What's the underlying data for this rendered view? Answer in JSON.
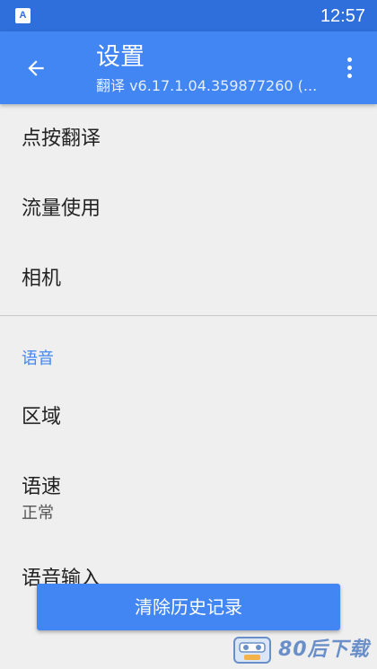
{
  "status_bar": {
    "app_icon_letter": "A",
    "time": "12:57"
  },
  "app_bar": {
    "back_icon": "arrow-left-icon",
    "title": "设置",
    "subtitle": "翻译 v6.17.1.04.359877260 (...",
    "more_icon": "more-vert-icon"
  },
  "settings": {
    "items": [
      {
        "title": "点按翻译"
      },
      {
        "title": "流量使用"
      },
      {
        "title": "相机"
      }
    ],
    "voice_section": {
      "header": "语音",
      "items": [
        {
          "title": "区域"
        },
        {
          "title": "语速",
          "summary": "正常"
        },
        {
          "title": "语音输入"
        }
      ]
    }
  },
  "clear_history_button": {
    "label": "清除历史记录"
  },
  "watermark": {
    "text": "80后下载"
  },
  "colors": {
    "status_bar": "#2f6fdb",
    "app_bar": "#4286f4",
    "accent": "#4286f4",
    "background": "#efefef"
  }
}
